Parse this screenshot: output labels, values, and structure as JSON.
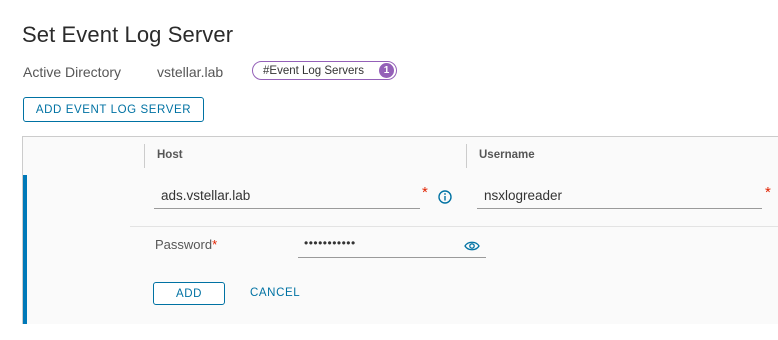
{
  "page": {
    "title": "Set Event Log Server"
  },
  "meta": {
    "directory_type": "Active Directory",
    "domain": "vstellar.lab",
    "tag": {
      "label": "#Event Log Servers",
      "count": "1",
      "color": "#9460b8"
    }
  },
  "toolbar": {
    "add_event_log_server_label": "ADD EVENT LOG SERVER"
  },
  "grid": {
    "columns": [
      "Host",
      "Username"
    ],
    "edit_row": {
      "host_value": "ads.vstellar.lab",
      "username_value": "nsxlogreader",
      "password_label": "Password",
      "password_value": "•••••••••••",
      "required_marker": "*",
      "add_label": "ADD",
      "cancel_label": "CANCEL"
    }
  },
  "colors": {
    "accent": "#0072a3",
    "row_accent": "#0079b8",
    "required": "#e12200"
  },
  "icons": {
    "host_info": "info-icon",
    "password_toggle": "eye-icon"
  }
}
